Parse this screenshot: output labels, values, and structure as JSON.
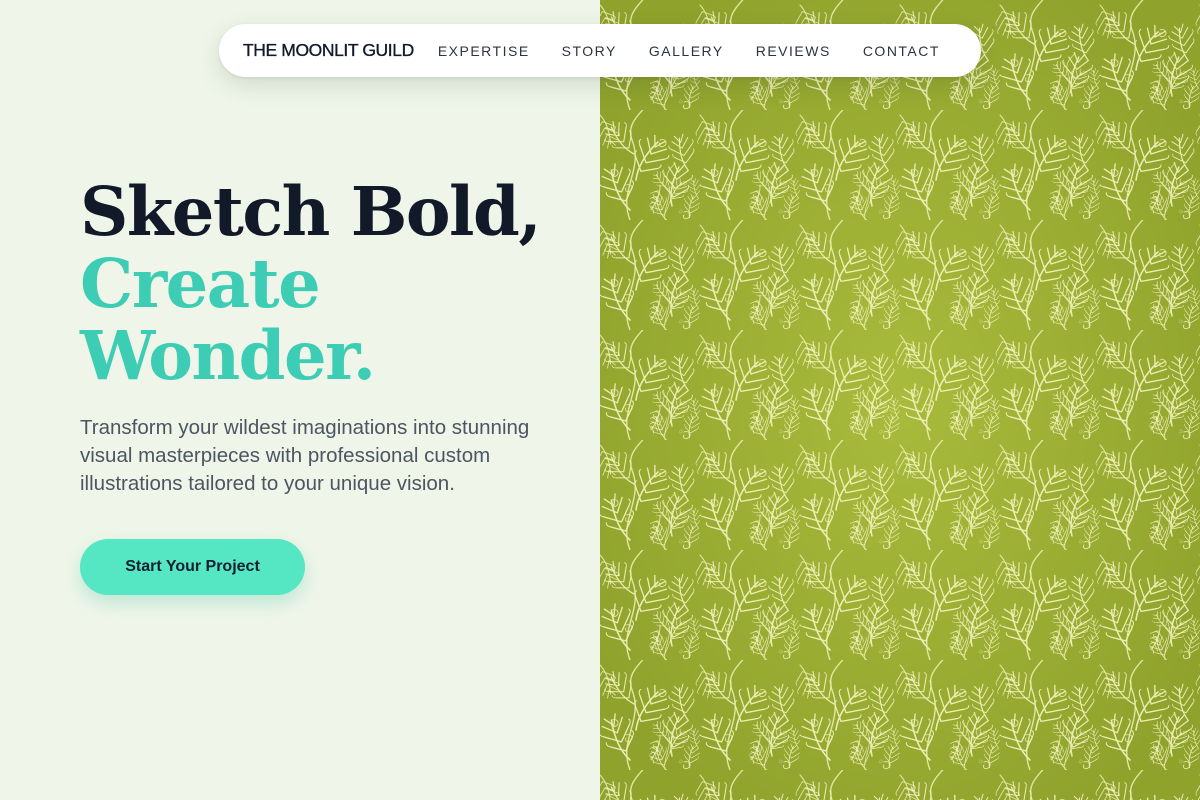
{
  "brand": {
    "name": "THE MOONLIT GUILD"
  },
  "nav": {
    "links": [
      {
        "label": "EXPERTISE"
      },
      {
        "label": "STORY"
      },
      {
        "label": "GALLERY"
      },
      {
        "label": "REVIEWS"
      },
      {
        "label": "CONTACT"
      }
    ]
  },
  "hero": {
    "title_line1": "Sketch Bold,",
    "title_line2": "Create",
    "title_line3": "Wonder.",
    "subtitle": "Transform your wildest imaginations into stunning visual masterpieces with professional custom illustrations tailored to your unique vision.",
    "cta_label": "Start Your Project"
  },
  "colors": {
    "background": "#eff6e9",
    "accent": "#3dcdb4",
    "cta": "#55e6c3",
    "heading": "#121a2a",
    "pattern_base": "#9aae33",
    "pattern_leaf": "#f3f4bd"
  },
  "icons": {
    "art_panel": "leafy-fern-pattern"
  }
}
